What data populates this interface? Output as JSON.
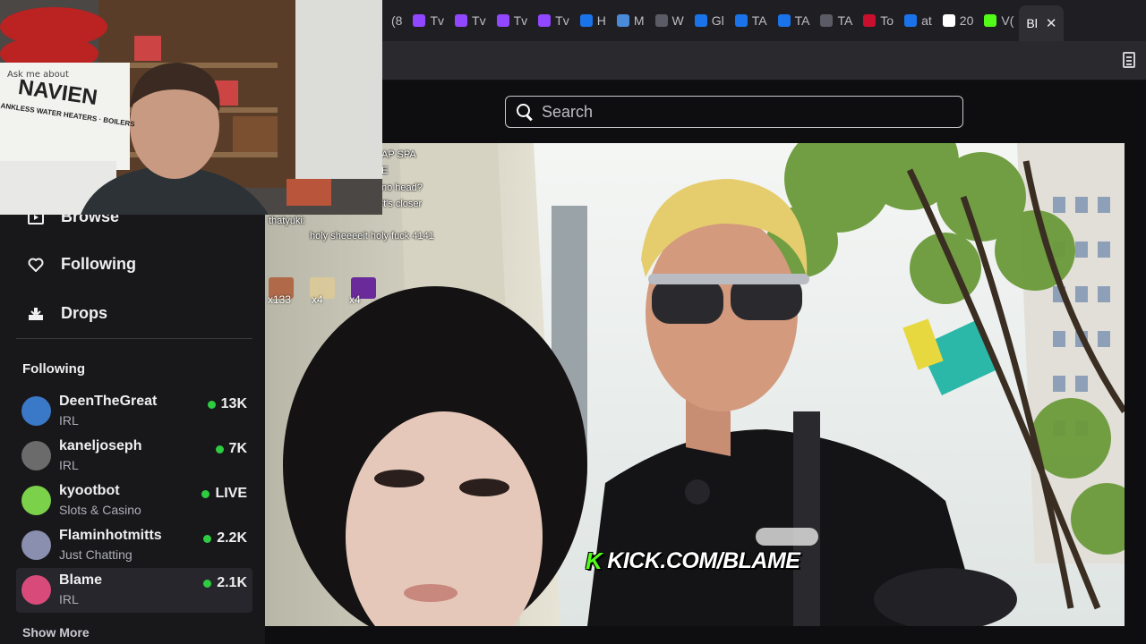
{
  "browser": {
    "tabs": [
      {
        "label": "(8",
        "color": "#1f1f23"
      },
      {
        "label": "Tv",
        "color": "#9146ff"
      },
      {
        "label": "Tv",
        "color": "#9146ff"
      },
      {
        "label": "Tv",
        "color": "#9146ff"
      },
      {
        "label": "Tv",
        "color": "#9146ff"
      },
      {
        "label": "H",
        "color": "#1a73e8"
      },
      {
        "label": "M",
        "color": "#4a8ad8"
      },
      {
        "label": "W",
        "color": "#5b5b66"
      },
      {
        "label": "Gl",
        "color": "#1a73e8"
      },
      {
        "label": "TA",
        "color": "#1a73e8"
      },
      {
        "label": "TA",
        "color": "#1a73e8"
      },
      {
        "label": "TA",
        "color": "#5b5b66"
      },
      {
        "label": "To",
        "color": "#c8102e"
      },
      {
        "label": "at",
        "color": "#1a73e8"
      },
      {
        "label": "20",
        "color": "#ffffff"
      },
      {
        "label": "V(",
        "color": "#53fc18"
      }
    ],
    "active_tab": {
      "label": "Bl"
    }
  },
  "topnav": {
    "search_placeholder": "Search"
  },
  "sidebar": {
    "nav": [
      {
        "label": "Browse",
        "icon": "browse-icon"
      },
      {
        "label": "Following",
        "icon": "heart-icon"
      },
      {
        "label": "Drops",
        "icon": "drops-icon"
      }
    ],
    "following_header": "Following",
    "channels": [
      {
        "name": "DeenTheGreat",
        "category": "IRL",
        "viewers": "13K",
        "avatar_color": "#3a78c8"
      },
      {
        "name": "kaneljoseph",
        "category": "IRL",
        "viewers": "7K",
        "avatar_color": "#6b6b6b"
      },
      {
        "name": "kyootbot",
        "category": "Slots & Casino",
        "viewers": "LIVE",
        "avatar_color": "#7bd14a"
      },
      {
        "name": "Flaminhotmitts",
        "category": "Just Chatting",
        "viewers": "2.2K",
        "avatar_color": "#8a8fb0"
      },
      {
        "name": "Blame",
        "category": "IRL",
        "viewers": "2.1K",
        "avatar_color": "#d84a7a"
      }
    ],
    "show_more": "Show More"
  },
  "overlay": {
    "chat": [
      {
        "text": "AP SPA"
      },
      {
        "text": "E"
      },
      {
        "text": "no head?"
      },
      {
        "text": "'t's closer"
      },
      {
        "text": "thatyuki:"
      },
      {
        "text": "holy sheeeeit holy fuck 4141"
      }
    ],
    "emote_counts": [
      "x133",
      "x4",
      "x4"
    ],
    "watermark": "KICK.COM/BLAME",
    "watermark_k": "K"
  },
  "webcam": {
    "sign_line1": "Ask me about",
    "sign_brand": "NAVIEN",
    "sign_line2": "ANKLESS WATER HEATERS · BOILERS"
  },
  "colors": {
    "accent_live": "#2ecc40",
    "kick_green": "#53fc18",
    "sidebar_bg": "#18181b"
  }
}
